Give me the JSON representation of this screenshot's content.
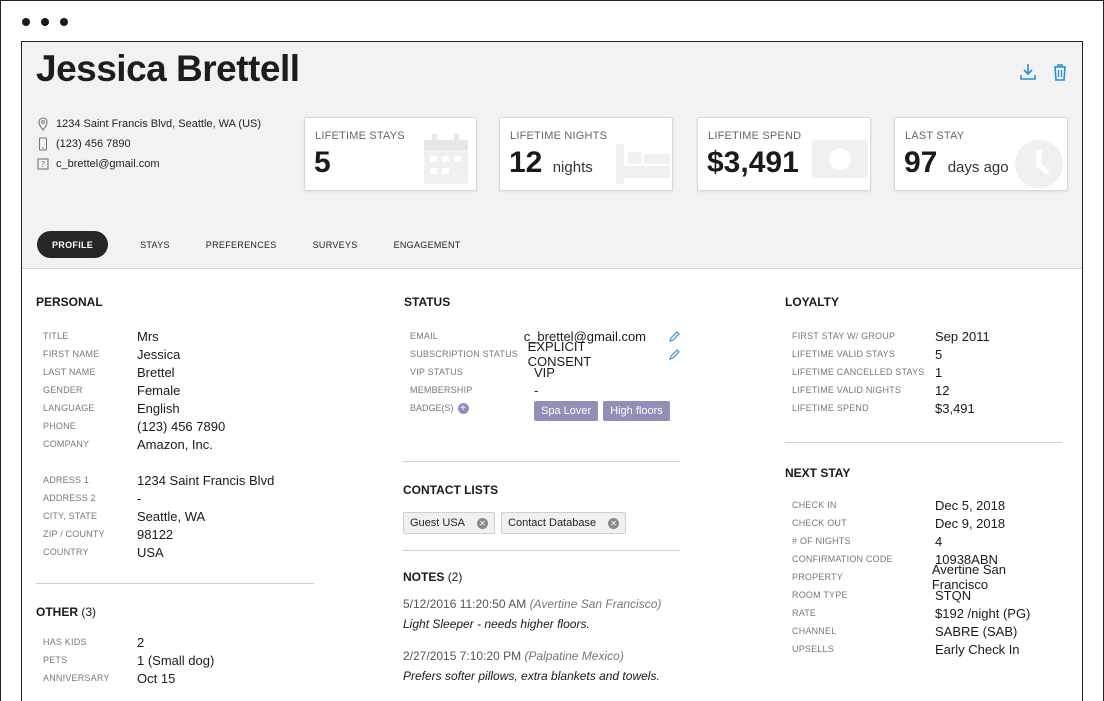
{
  "guest": {
    "name": "Jessica Brettell",
    "address": "1234 Saint Francis Blvd, Seattle, WA (US)",
    "phone": "(123) 456 7890",
    "email": "c_brettel@gmail.com"
  },
  "stats": [
    {
      "label": "LIFETIME STAYS",
      "value": "5",
      "unit": "",
      "icon": "calendar-icon"
    },
    {
      "label": "LIFETIME NIGHTS",
      "value": "12",
      "unit": "nights",
      "icon": "bed-icon"
    },
    {
      "label": "LIFETIME SPEND",
      "value": "$3,491",
      "unit": "",
      "icon": "money-icon"
    },
    {
      "label": "LAST STAY",
      "value": "97",
      "unit": "days ago",
      "icon": "clock-icon"
    }
  ],
  "tabs": [
    "PROFILE",
    "STAYS",
    "PREFERENCES",
    "SURVEYS",
    "ENGAGEMENT"
  ],
  "active_tab": "PROFILE",
  "personal": {
    "title": "PERSONAL",
    "rows": [
      {
        "k": "TITLE",
        "v": "Mrs"
      },
      {
        "k": "FIRST NAME",
        "v": "Jessica"
      },
      {
        "k": "LAST NAME",
        "v": "Brettel"
      },
      {
        "k": "GENDER",
        "v": "Female"
      },
      {
        "k": "LANGUAGE",
        "v": "English"
      },
      {
        "k": "PHONE",
        "v": "(123) 456 7890"
      },
      {
        "k": "COMPANY",
        "v": "Amazon, Inc."
      }
    ],
    "address_rows": [
      {
        "k": "ADRESS 1",
        "v": "1234 Saint Francis Blvd"
      },
      {
        "k": "ADDRESS 2",
        "v": "-"
      },
      {
        "k": "CITY, STATE",
        "v": "Seattle, WA"
      },
      {
        "k": "ZIP / COUNTY",
        "v": "98122"
      },
      {
        "k": "COUNTRY",
        "v": "USA"
      }
    ]
  },
  "other": {
    "title": "OTHER",
    "count": "(3)",
    "rows": [
      {
        "k": "HAS KIDS",
        "v": "2"
      },
      {
        "k": "PETS",
        "v": "1 (Small dog)"
      },
      {
        "k": "ANNIVERSARY",
        "v": "Oct 15"
      }
    ]
  },
  "status": {
    "title": "STATUS",
    "rows": [
      {
        "k": "EMAIL",
        "v": "c_brettel@gmail.com"
      },
      {
        "k": "SUBSCRIPTION STATUS",
        "v": "EXPLICIT CONSENT"
      },
      {
        "k": "VIP STATUS",
        "v": "VIP"
      },
      {
        "k": "MEMBERSHIP",
        "v": "-"
      }
    ],
    "badges_label": "BADGE(S)",
    "badges": [
      "Spa Lover",
      "High floors"
    ]
  },
  "contact_lists": {
    "title": "CONTACT LISTS",
    "items": [
      "Guest USA",
      "Contact Database"
    ]
  },
  "notes": {
    "title": "NOTES",
    "count": "(2)",
    "items": [
      {
        "date": "5/12/2016 11:20:50 AM",
        "location": "(Avertine San Francisco)",
        "text": "Light Sleeper - needs higher floors."
      },
      {
        "date": "2/27/2015 7:10:20 PM",
        "location": "(Palpatine Mexico)",
        "text": "Prefers softer pillows, extra blankets and towels."
      }
    ]
  },
  "loyalty": {
    "title": "LOYALTY",
    "rows": [
      {
        "k": "FIRST STAY W/ GROUP",
        "v": "Sep 2011"
      },
      {
        "k": "LIFETIME VALID STAYS",
        "v": "5"
      },
      {
        "k": "LIFETIME CANCELLED STAYS",
        "v": "1"
      },
      {
        "k": "LIFETIME VALID NIGHTS",
        "v": "12"
      },
      {
        "k": "LIFETIME SPEND",
        "v": "$3,491"
      }
    ]
  },
  "next_stay": {
    "title": "NEXT STAY",
    "rows": [
      {
        "k": "CHECK IN",
        "v": "Dec 5, 2018"
      },
      {
        "k": "CHECK OUT",
        "v": "Dec 9, 2018"
      },
      {
        "k": "# OF NIGHTS",
        "v": "4"
      },
      {
        "k": "CONFIRMATION CODE",
        "v": "10938ABN"
      },
      {
        "k": "PROPERTY",
        "v": "Avertine San Francisco"
      },
      {
        "k": "ROOM TYPE",
        "v": "STQN"
      },
      {
        "k": "RATE",
        "v": "$192 /night (PG)"
      },
      {
        "k": "CHANNEL",
        "v": "SABRE (SAB)"
      },
      {
        "k": "UPSELLS",
        "v": "Early Check In"
      }
    ]
  },
  "colors": {
    "accent": "#2a8fd6",
    "badge": "#8f8fb8",
    "alert": "#d0502a",
    "tab_active": "#262626"
  }
}
